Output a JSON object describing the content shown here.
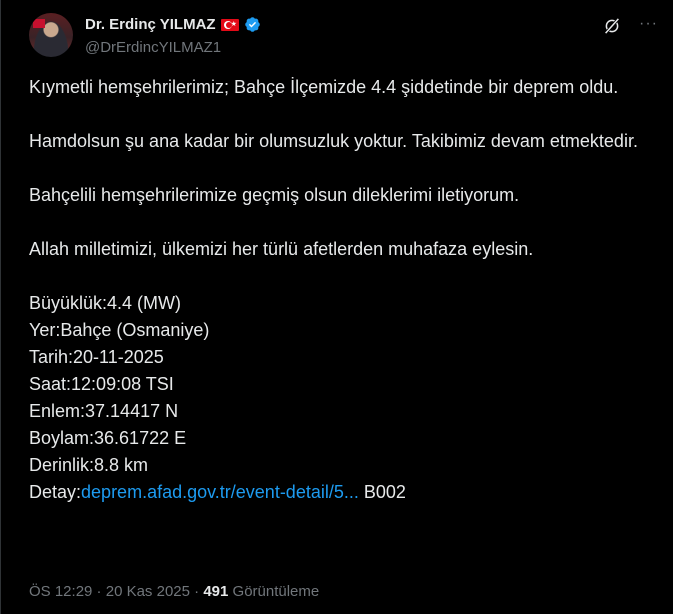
{
  "author": {
    "name": "Dr. Erdinç YILMAZ",
    "handle": "@DrErdincYILMAZ1"
  },
  "icons": {
    "flag": "turkey-flag-icon",
    "verified": "verified-badge-icon",
    "grok": "grok-icon",
    "more": "more-options-icon"
  },
  "tweet": {
    "p1": "Kıymetli hemşehrilerimiz; Bahçe İlçemizde 4.4 şiddetinde bir deprem oldu.",
    "p2": "Hamdolsun şu ana kadar bir olumsuzluk yoktur. Takibimiz devam etmektedir.",
    "p3": "Bahçelili hemşehrilerimize geçmiş olsun dileklerimi iletiyorum.",
    "p4": "Allah milletimizi, ülkemizi her türlü afetlerden muhafaza eylesin.",
    "details": [
      "Büyüklük:4.4 (MW)",
      "Yer:Bahçe (Osmaniye)",
      "Tarih:20-11-2025",
      "Saat:12:09:08 TSI",
      "Enlem:37.14417 N",
      "Boylam:36.61722 E",
      "Derinlik:8.8 km"
    ],
    "detay_label": "Detay:",
    "detay_link": "deprem.afad.gov.tr/event-detail/5...",
    "detay_suffix": " B002"
  },
  "meta": {
    "time": "ÖS 12:29",
    "sep1": " · ",
    "date": "20 Kas 2025",
    "sep2": " · ",
    "views": "491",
    "views_label": " Görüntüleme"
  },
  "colors": {
    "background": "#000000",
    "text": "#e7e9ea",
    "secondary": "#71767b",
    "link": "#1d9bf0",
    "verified": "#1d9bf0"
  }
}
